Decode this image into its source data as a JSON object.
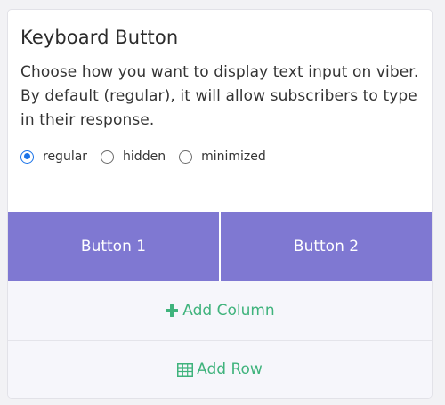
{
  "card": {
    "title": "Keyboard Button",
    "description": "Choose how you want to display text input on viber. By default (regular), it will allow subscribers to type in their response."
  },
  "radio_options": [
    {
      "label": "regular",
      "checked": true
    },
    {
      "label": "hidden",
      "checked": false
    },
    {
      "label": "minimized",
      "checked": false
    }
  ],
  "buttons": [
    {
      "label": "Button 1"
    },
    {
      "label": "Button 2"
    }
  ],
  "actions": {
    "add_column_label": "Add Column",
    "add_column_icon": "plus-icon",
    "add_row_label": "Add Row",
    "add_row_icon": "table-icon"
  },
  "colors": {
    "button_bg": "#7f78d2",
    "action_green": "#3fb37c",
    "radio_checked": "#1a73e8"
  }
}
